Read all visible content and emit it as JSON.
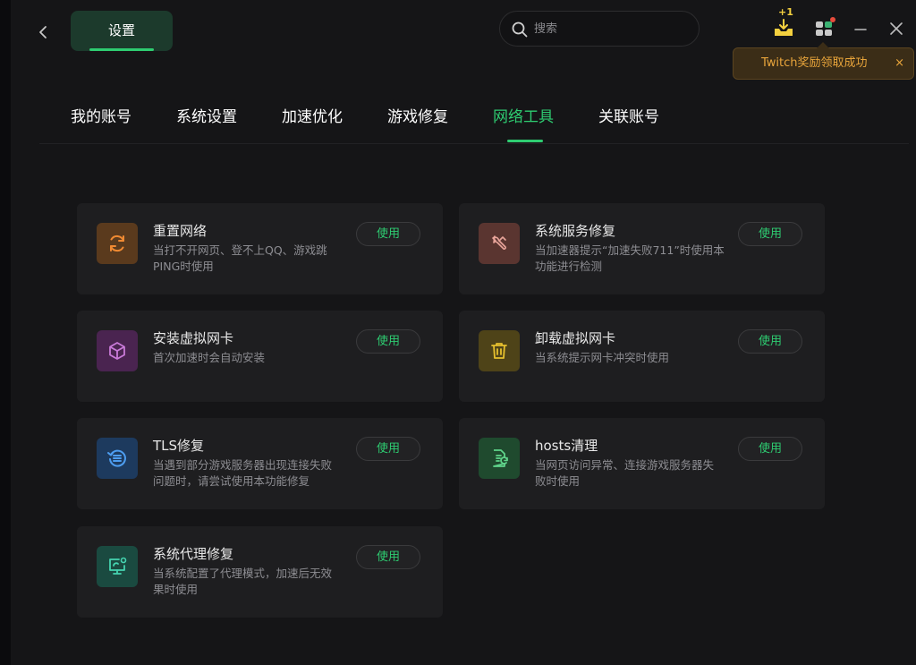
{
  "header": {
    "settings_tab": "设置",
    "search_placeholder": "搜索",
    "reward_badge": "+1"
  },
  "toast": {
    "text": "Twitch奖励领取成功",
    "close": "×"
  },
  "nav": {
    "tabs": [
      {
        "label": "我的账号"
      },
      {
        "label": "系统设置"
      },
      {
        "label": "加速优化"
      },
      {
        "label": "游戏修复"
      },
      {
        "label": "网络工具"
      },
      {
        "label": "关联账号"
      }
    ],
    "active": "网络工具"
  },
  "tools": [
    {
      "title": "重置网络",
      "desc": "当打不开网页、登不上QQ、游戏跳PING时使用",
      "button": "使用",
      "icon": "refresh-icon",
      "bg": "#5a3a1d",
      "fg": "#f08a32"
    },
    {
      "title": "系统服务修复",
      "desc": "当加速器提示“加速失败711”时使用本功能进行检测",
      "button": "使用",
      "icon": "wrench-icon",
      "bg": "#5a3530",
      "fg": "#e8a49a"
    },
    {
      "title": "安装虚拟网卡",
      "desc": "首次加速时会自动安装",
      "button": "使用",
      "icon": "cube-icon",
      "bg": "#4a2450",
      "fg": "#c97ad8"
    },
    {
      "title": "卸载虚拟网卡",
      "desc": "当系统提示网卡冲突时使用",
      "button": "使用",
      "icon": "trash-icon",
      "bg": "#4e4318",
      "fg": "#e6c02e"
    },
    {
      "title": "TLS修复",
      "desc": "当遇到部分游戏服务器出现连接失败问题时，请尝试使用本功能修复",
      "button": "使用",
      "icon": "tls-icon",
      "bg": "#1d3a5e",
      "fg": "#4d9df0"
    },
    {
      "title": "hosts清理",
      "desc": "当网页访问异常、连接游戏服务器失败时使用",
      "button": "使用",
      "icon": "document-icon",
      "bg": "#1f4a2e",
      "fg": "#5fd38a"
    },
    {
      "title": "系统代理修复",
      "desc": "当系统配置了代理模式，加速后无效果时使用",
      "button": "使用",
      "icon": "monitor-icon",
      "bg": "#1a4a40",
      "fg": "#45d3b0"
    }
  ]
}
